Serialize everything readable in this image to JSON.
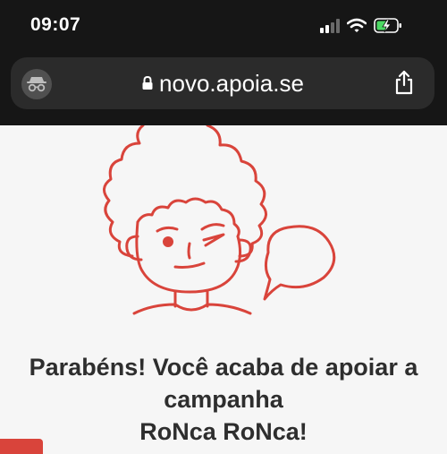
{
  "status_bar": {
    "time": "09:07",
    "icons": [
      "signal-icon",
      "wifi-icon",
      "battery-charging-icon"
    ]
  },
  "browser": {
    "url": "novo.apoia.se",
    "mode_icon": "incognito-icon",
    "secure_icon": "lock-icon",
    "share_icon": "share-icon"
  },
  "page": {
    "illustration": "winking-curly-haired-face-with-speech-bubble",
    "heading_lines": [
      "Parabéns! Você acaba de apoiar a",
      "campanha",
      "RoNca RoNca!"
    ]
  },
  "colors": {
    "browser_chrome": "#161616",
    "address_bar": "#2b2b2b",
    "illustration_stroke": "#d9443b",
    "heading_text": "#2e2e2e",
    "page_background": "#f6f6f6"
  }
}
